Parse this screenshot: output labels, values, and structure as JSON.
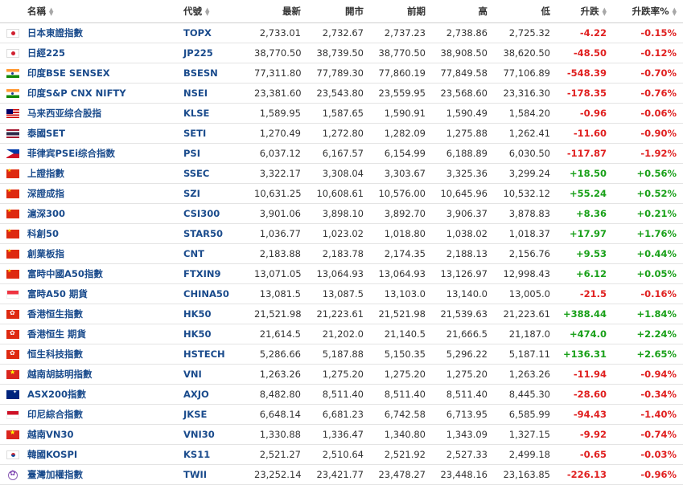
{
  "headers": {
    "name": "名稱",
    "code": "代號",
    "last": "最新",
    "open": "開市",
    "prev": "前期",
    "high": "高",
    "low": "低",
    "change": "升跌",
    "change_pct": "升跌率%"
  },
  "sort_icons": {
    "up": "▲",
    "down": "▼"
  },
  "colors": {
    "up": "#19a019",
    "down": "#e02020",
    "link": "#1a4b8c"
  },
  "rows": [
    {
      "flag": "jp",
      "name": "日本東證指數",
      "code": "TOPX",
      "last": "2,733.01",
      "open": "2,732.67",
      "prev": "2,737.23",
      "high": "2,738.86",
      "low": "2,725.32",
      "change": "-4.22",
      "change_pct": "-0.15%",
      "dir": "down"
    },
    {
      "flag": "jp",
      "name": "日經225",
      "code": "JP225",
      "last": "38,770.50",
      "open": "38,739.50",
      "prev": "38,770.50",
      "high": "38,908.50",
      "low": "38,620.50",
      "change": "-48.50",
      "change_pct": "-0.12%",
      "dir": "down"
    },
    {
      "flag": "in",
      "name": "印度BSE SENSEX",
      "code": "BSESN",
      "last": "77,311.80",
      "open": "77,789.30",
      "prev": "77,860.19",
      "high": "77,849.58",
      "low": "77,106.89",
      "change": "-548.39",
      "change_pct": "-0.70%",
      "dir": "down"
    },
    {
      "flag": "in",
      "name": "印度S&P CNX NIFTY",
      "code": "NSEI",
      "last": "23,381.60",
      "open": "23,543.80",
      "prev": "23,559.95",
      "high": "23,568.60",
      "low": "23,316.30",
      "change": "-178.35",
      "change_pct": "-0.76%",
      "dir": "down"
    },
    {
      "flag": "my",
      "name": "马来西亚综合股指",
      "code": "KLSE",
      "last": "1,589.95",
      "open": "1,587.65",
      "prev": "1,590.91",
      "high": "1,590.49",
      "low": "1,584.20",
      "change": "-0.96",
      "change_pct": "-0.06%",
      "dir": "down"
    },
    {
      "flag": "th",
      "name": "泰國SET",
      "code": "SETI",
      "last": "1,270.49",
      "open": "1,272.80",
      "prev": "1,282.09",
      "high": "1,275.88",
      "low": "1,262.41",
      "change": "-11.60",
      "change_pct": "-0.90%",
      "dir": "down"
    },
    {
      "flag": "ph",
      "name": "菲律宾PSEi综合指数",
      "code": "PSI",
      "last": "6,037.12",
      "open": "6,167.57",
      "prev": "6,154.99",
      "high": "6,188.89",
      "low": "6,030.50",
      "change": "-117.87",
      "change_pct": "-1.92%",
      "dir": "down"
    },
    {
      "flag": "cn",
      "name": "上證指數",
      "code": "SSEC",
      "last": "3,322.17",
      "open": "3,308.04",
      "prev": "3,303.67",
      "high": "3,325.36",
      "low": "3,299.24",
      "change": "+18.50",
      "change_pct": "+0.56%",
      "dir": "up"
    },
    {
      "flag": "cn",
      "name": "深證成指",
      "code": "SZI",
      "last": "10,631.25",
      "open": "10,608.61",
      "prev": "10,576.00",
      "high": "10,645.96",
      "low": "10,532.12",
      "change": "+55.24",
      "change_pct": "+0.52%",
      "dir": "up"
    },
    {
      "flag": "cn",
      "name": "滬深300",
      "code": "CSI300",
      "last": "3,901.06",
      "open": "3,898.10",
      "prev": "3,892.70",
      "high": "3,906.37",
      "low": "3,878.83",
      "change": "+8.36",
      "change_pct": "+0.21%",
      "dir": "up"
    },
    {
      "flag": "cn",
      "name": "科創50",
      "code": "STAR50",
      "last": "1,036.77",
      "open": "1,023.02",
      "prev": "1,018.80",
      "high": "1,038.02",
      "low": "1,018.37",
      "change": "+17.97",
      "change_pct": "+1.76%",
      "dir": "up"
    },
    {
      "flag": "cn",
      "name": "創業板指",
      "code": "CNT",
      "last": "2,183.88",
      "open": "2,183.78",
      "prev": "2,174.35",
      "high": "2,188.13",
      "low": "2,156.76",
      "change": "+9.53",
      "change_pct": "+0.44%",
      "dir": "up"
    },
    {
      "flag": "cn",
      "name": "富時中國A50指數",
      "code": "FTXIN9",
      "last": "13,071.05",
      "open": "13,064.93",
      "prev": "13,064.93",
      "high": "13,126.97",
      "low": "12,998.43",
      "change": "+6.12",
      "change_pct": "+0.05%",
      "dir": "up"
    },
    {
      "flag": "sg",
      "name": "富時A50 期貨",
      "code": "CHINA50",
      "last": "13,081.5",
      "open": "13,087.5",
      "prev": "13,103.0",
      "high": "13,140.0",
      "low": "13,005.0",
      "change": "-21.5",
      "change_pct": "-0.16%",
      "dir": "down"
    },
    {
      "flag": "hk",
      "name": "香港恒生指數",
      "code": "HK50",
      "last": "21,521.98",
      "open": "21,223.61",
      "prev": "21,521.98",
      "high": "21,539.63",
      "low": "21,223.61",
      "change": "+388.44",
      "change_pct": "+1.84%",
      "dir": "up"
    },
    {
      "flag": "hk",
      "name": "香港恒生 期貨",
      "code": "HK50",
      "last": "21,614.5",
      "open": "21,202.0",
      "prev": "21,140.5",
      "high": "21,666.5",
      "low": "21,187.0",
      "change": "+474.0",
      "change_pct": "+2.24%",
      "dir": "up"
    },
    {
      "flag": "hk",
      "name": "恒生科技指數",
      "code": "HSTECH",
      "last": "5,286.66",
      "open": "5,187.88",
      "prev": "5,150.35",
      "high": "5,296.22",
      "low": "5,187.11",
      "change": "+136.31",
      "change_pct": "+2.65%",
      "dir": "up"
    },
    {
      "flag": "vn",
      "name": "越南胡誌明指數",
      "code": "VNI",
      "last": "1,263.26",
      "open": "1,275.20",
      "prev": "1,275.20",
      "high": "1,275.20",
      "low": "1,263.26",
      "change": "-11.94",
      "change_pct": "-0.94%",
      "dir": "down"
    },
    {
      "flag": "au",
      "name": "ASX200指數",
      "code": "AXJO",
      "last": "8,482.80",
      "open": "8,511.40",
      "prev": "8,511.40",
      "high": "8,511.40",
      "low": "8,445.30",
      "change": "-28.60",
      "change_pct": "-0.34%",
      "dir": "down"
    },
    {
      "flag": "id",
      "name": "印尼綜合指數",
      "code": "JKSE",
      "last": "6,648.14",
      "open": "6,681.23",
      "prev": "6,742.58",
      "high": "6,713.95",
      "low": "6,585.99",
      "change": "-94.43",
      "change_pct": "-1.40%",
      "dir": "down"
    },
    {
      "flag": "vn",
      "name": "越南VN30",
      "code": "VNI30",
      "last": "1,330.88",
      "open": "1,336.47",
      "prev": "1,340.80",
      "high": "1,343.09",
      "low": "1,327.15",
      "change": "-9.92",
      "change_pct": "-0.74%",
      "dir": "down"
    },
    {
      "flag": "kr",
      "name": "韓國KOSPI",
      "code": "KS11",
      "last": "2,521.27",
      "open": "2,510.64",
      "prev": "2,521.92",
      "high": "2,527.33",
      "low": "2,499.18",
      "change": "-0.65",
      "change_pct": "-0.03%",
      "dir": "down"
    },
    {
      "flag": "tw",
      "name": "臺灣加權指數",
      "code": "TWII",
      "last": "23,252.14",
      "open": "23,421.77",
      "prev": "23,478.27",
      "high": "23,448.16",
      "low": "23,163.85",
      "change": "-226.13",
      "change_pct": "-0.96%",
      "dir": "down"
    }
  ]
}
